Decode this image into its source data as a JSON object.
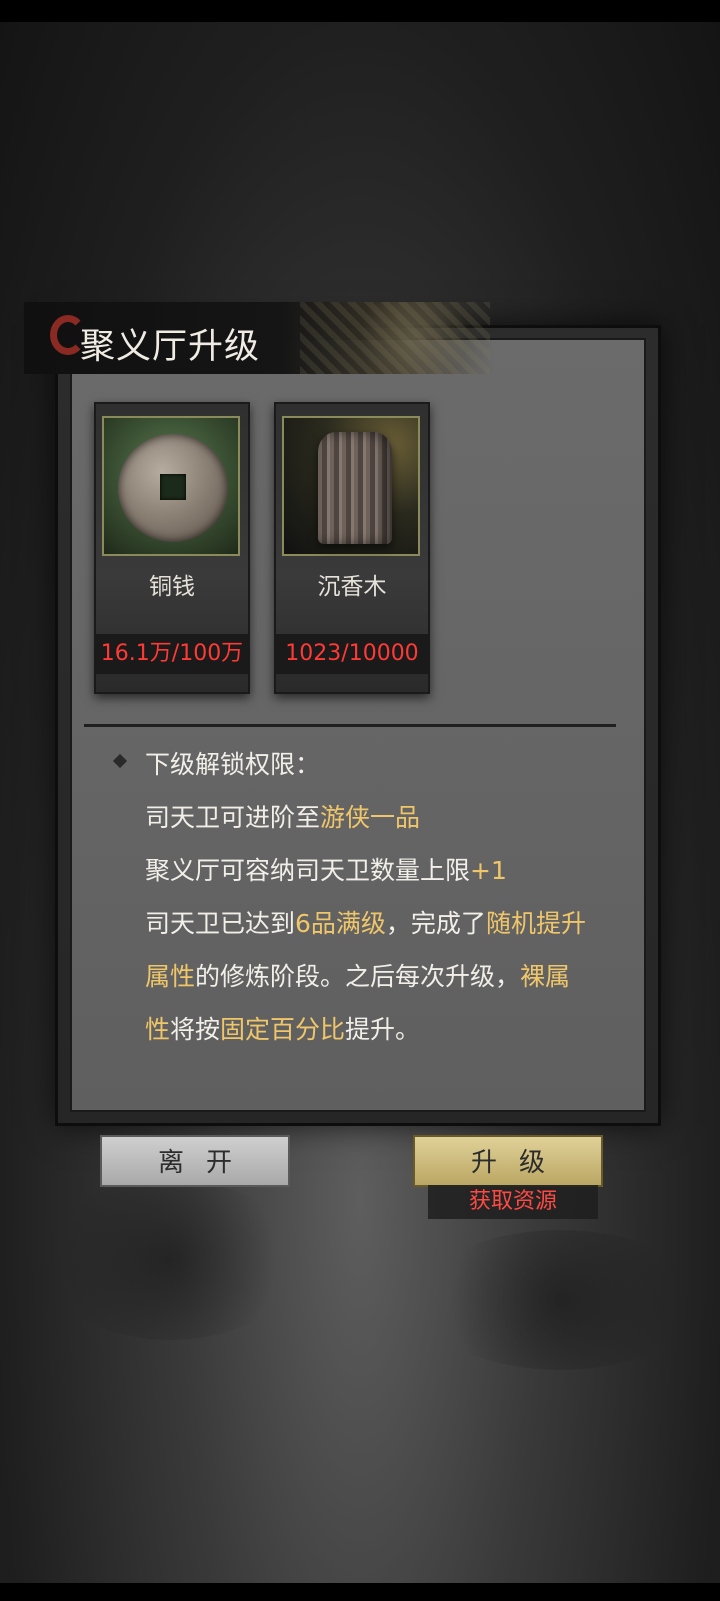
{
  "dialog": {
    "title": "聚义厅升级"
  },
  "resources": [
    {
      "name": "铜钱",
      "count": "16.1万/100万",
      "icon": "copper-coin-icon"
    },
    {
      "name": "沉香木",
      "count": "1023/10000",
      "icon": "agarwood-icon"
    }
  ],
  "unlock": {
    "heading": "下级解锁权限：",
    "line1_a": "司天卫可进阶至",
    "line1_b": "游侠一品",
    "line2_a": "聚义厅可容纳司天卫数量上限",
    "line2_b": "+1",
    "line3_a": "司天卫已达到",
    "line3_b": "6品满级",
    "line3_c": "，完成了",
    "line3_d": "随机提升",
    "line4_a": "属性",
    "line4_b": "的修炼阶段。之后每次升级，",
    "line4_c": "裸属",
    "line5_a": "性",
    "line5_b": "将按",
    "line5_c": "固定百分比",
    "line5_d": "提升。"
  },
  "buttons": {
    "leave": "离开",
    "upgrade": "升级",
    "get_resources": "获取资源"
  },
  "colors": {
    "highlight": "#f0c66a",
    "insufficient": "#ff3a36"
  }
}
